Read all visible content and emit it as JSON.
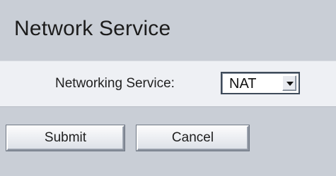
{
  "header": {
    "title": "Network Service"
  },
  "form": {
    "networking_service_label": "Networking Service:",
    "networking_service_value": "NAT"
  },
  "actions": {
    "submit_label": "Submit",
    "cancel_label": "Cancel"
  },
  "icons": {
    "dropdown": "chevron-down-icon"
  },
  "colors": {
    "page_background": "#c9ced6",
    "panel_background": "#eef0f4",
    "text": "#1f1f1f"
  }
}
